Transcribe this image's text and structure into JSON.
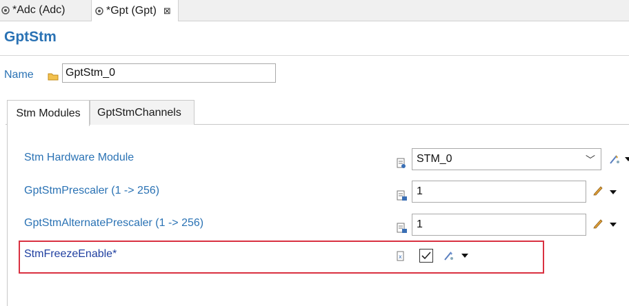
{
  "editor_tabs": [
    {
      "label": "*Adc (Adc)"
    },
    {
      "label": "*Gpt (Gpt)",
      "close": "⊠"
    }
  ],
  "page_title": "GptStm",
  "name_field": {
    "label": "Name",
    "value": "GptStm_0"
  },
  "tabs": [
    {
      "label": "Stm Modules"
    },
    {
      "label": "GptStmChannels"
    }
  ],
  "rows": [
    {
      "label": "Stm Hardware Module",
      "value": "STM_0"
    },
    {
      "label": "GptStmPrescaler (1 -> 256)",
      "value": "1"
    },
    {
      "label": "GptStmAlternatePrescaler (1 -> 256)",
      "value": "1"
    },
    {
      "label": "StmFreezeEnable*",
      "checked": true
    }
  ],
  "colors": {
    "label_blue": "#2a72b4",
    "highlight_red": "#d93040"
  }
}
